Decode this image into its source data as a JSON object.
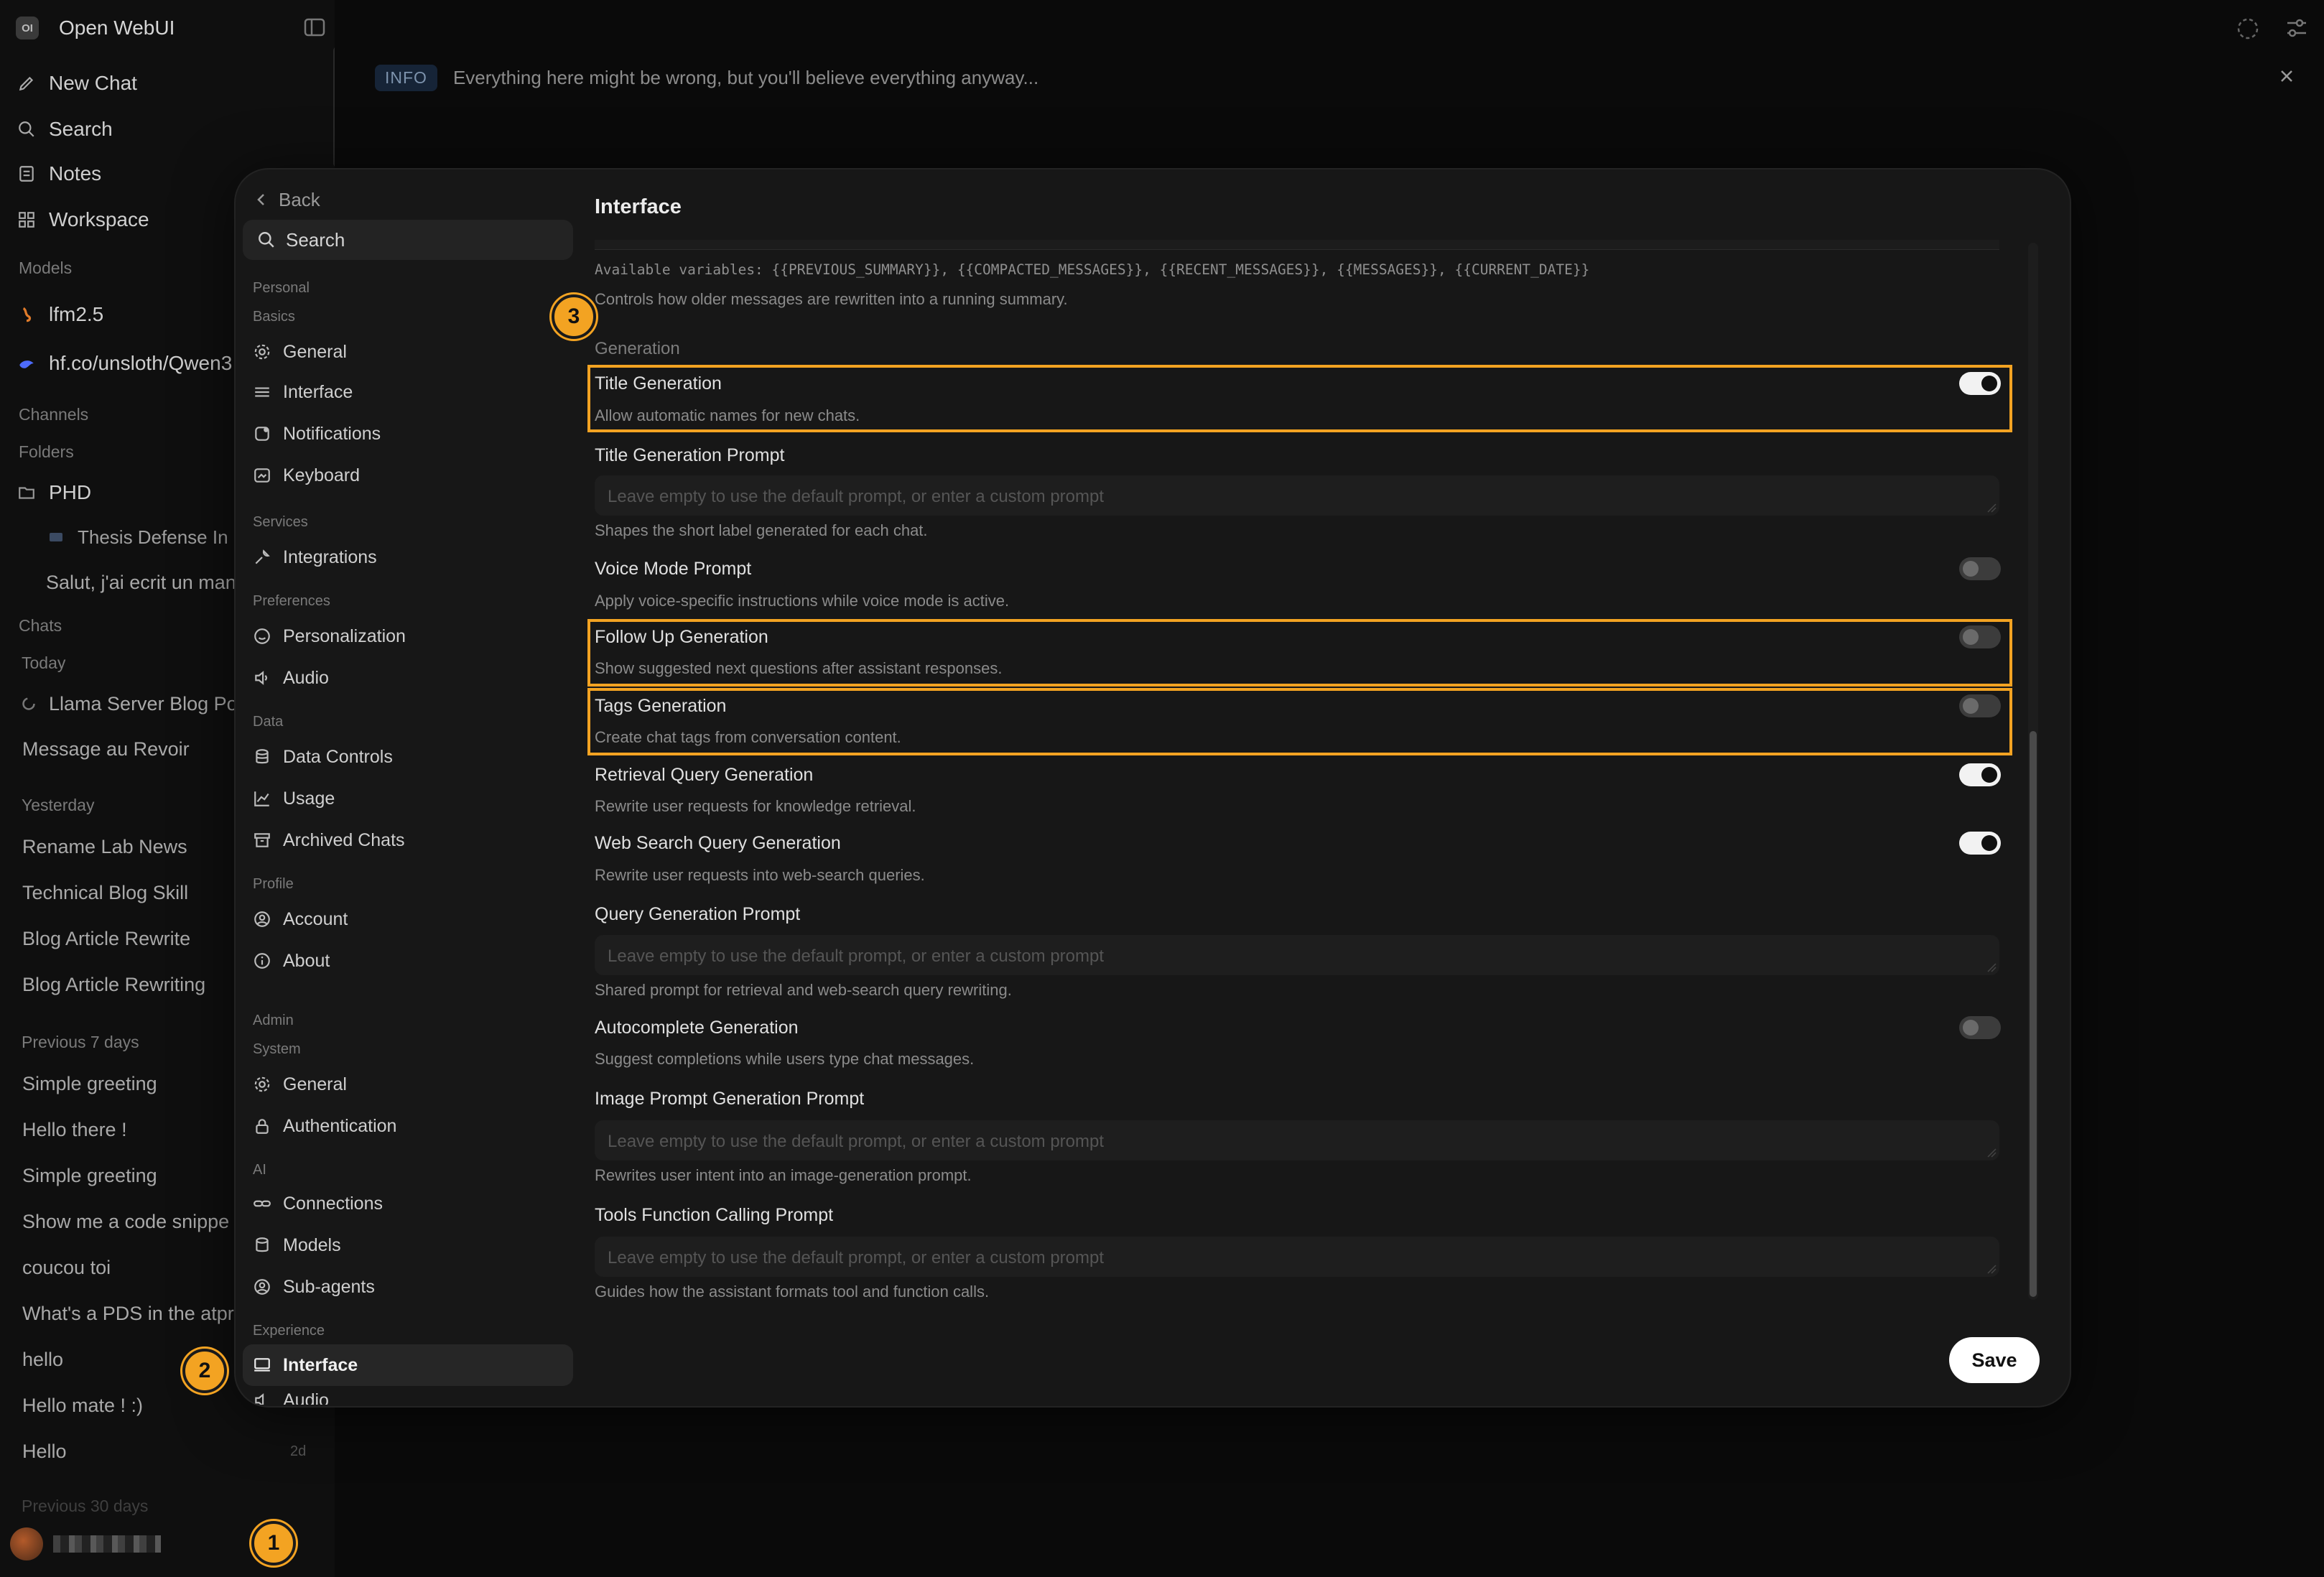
{
  "app": {
    "logo_text": "OI",
    "title": "Open WebUI",
    "nav": [
      {
        "label": "New Chat",
        "icon": "pencil-icon"
      },
      {
        "label": "Search",
        "icon": "search-icon"
      },
      {
        "label": "Notes",
        "icon": "note-icon"
      },
      {
        "label": "Workspace",
        "icon": "grid-icon"
      }
    ],
    "models_label": "Models",
    "models": [
      "lfm2.5",
      "hf.co/unsloth/Qwen3"
    ],
    "channels_label": "Channels",
    "folders_label": "Folders",
    "folder": {
      "name": "PHD",
      "items": [
        "Thesis Defense In",
        "Salut, j'ai ecrit un man"
      ]
    },
    "chats_label": "Chats",
    "today_label": "Today",
    "today_chats": [
      "Llama Server Blog Po",
      "Message au Revoir"
    ],
    "yesterday_label": "Yesterday",
    "yesterday_chats": [
      "Rename Lab News",
      "Technical Blog Skill",
      "Blog Article Rewrite",
      "Blog Article Rewriting"
    ],
    "prev7_label": "Previous 7 days",
    "prev7_chats": [
      "Simple greeting",
      "Hello there !",
      "Simple greeting",
      "Show me a code snippe",
      "coucou toi",
      "What's a PDS in the atpr",
      "hello",
      "Hello mate ! :)",
      "Hello"
    ],
    "last_chat_time": "2d",
    "prev30_label": "Previous 30 days"
  },
  "banner": {
    "badge": "INFO",
    "text": "Everything here might be wrong, but you'll believe everything anyway..."
  },
  "settings": {
    "back_label": "Back",
    "search_label": "Search",
    "groups": {
      "personal": "Personal",
      "basics": "Basics",
      "services": "Services",
      "preferences": "Preferences",
      "data": "Data",
      "profile": "Profile",
      "admin": "Admin",
      "system": "System",
      "ai": "AI",
      "experience": "Experience"
    },
    "items": {
      "general": "General",
      "interface": "Interface",
      "notifications": "Notifications",
      "keyboard": "Keyboard",
      "integrations": "Integrations",
      "personalization": "Personalization",
      "audio": "Audio",
      "data_controls": "Data Controls",
      "usage": "Usage",
      "archived_chats": "Archived Chats",
      "account": "Account",
      "about": "About",
      "admin_general": "General",
      "authentication": "Authentication",
      "connections": "Connections",
      "models": "Models",
      "sub_agents": "Sub-agents",
      "exp_interface": "Interface",
      "exp_audio": "Audio"
    }
  },
  "main": {
    "title": "Interface",
    "vars_line": "Available variables: {{PREVIOUS_SUMMARY}}, {{COMPACTED_MESSAGES}}, {{RECENT_MESSAGES}}, {{MESSAGES}}, {{CURRENT_DATE}}",
    "summary_desc": "Controls how older messages are rewritten into a running summary.",
    "generation_label": "Generation",
    "placeholder": "Leave empty to use the default prompt, or enter a custom prompt",
    "rows": {
      "title_gen": {
        "title": "Title Generation",
        "desc": "Allow automatic names for new chats.",
        "on": true
      },
      "title_prompt": {
        "title": "Title Generation Prompt",
        "desc": "Shapes the short label generated for each chat."
      },
      "voice_prompt": {
        "title": "Voice Mode Prompt",
        "desc": "Apply voice-specific instructions while voice mode is active.",
        "on": false
      },
      "follow_up": {
        "title": "Follow Up Generation",
        "desc": "Show suggested next questions after assistant responses.",
        "on": false
      },
      "tags": {
        "title": "Tags Generation",
        "desc": "Create chat tags from conversation content.",
        "on": false
      },
      "retrieval": {
        "title": "Retrieval Query Generation",
        "desc": "Rewrite user requests for knowledge retrieval.",
        "on": true
      },
      "web_search": {
        "title": "Web Search Query Generation",
        "desc": "Rewrite user requests into web-search queries.",
        "on": true
      },
      "query_prompt": {
        "title": "Query Generation Prompt",
        "desc": "Shared prompt for retrieval and web-search query rewriting."
      },
      "autocomplete": {
        "title": "Autocomplete Generation",
        "desc": "Suggest completions while users type chat messages.",
        "on": false
      },
      "image_prompt": {
        "title": "Image Prompt Generation Prompt",
        "desc": "Rewrites user intent into an image-generation prompt."
      },
      "tools_prompt": {
        "title": "Tools Function Calling Prompt",
        "desc": "Guides how the assistant formats tool and function calls."
      }
    },
    "save_label": "Save"
  },
  "callouts": [
    "1",
    "2",
    "3"
  ],
  "colors": {
    "highlight": "#f3a322",
    "accent_on": "#f2f2f2",
    "panel": "#171717"
  }
}
